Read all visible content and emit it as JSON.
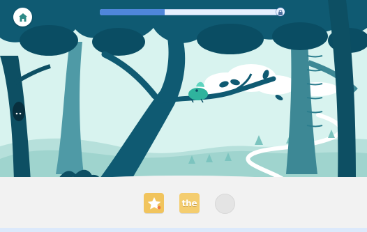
{
  "game": {
    "progress_fraction": 0.36
  },
  "controls": {
    "home_icon": "home-icon",
    "lock_icon": "lock-icon"
  },
  "collectibles": {
    "items": [
      {
        "icon": "star-icon",
        "state": "collected"
      },
      {
        "text": "the",
        "state": "collected"
      },
      {
        "icon": "empty-circle",
        "state": "empty"
      }
    ]
  },
  "colors": {
    "sky": "#cfeee9",
    "deep_teal": "#0f5a72",
    "mid_teal": "#2c7e8e",
    "light_teal": "#76c3bd",
    "progress_fill": "#4f86da",
    "tray": "#f2f2f2",
    "star_slot": "#f1c45d",
    "word_slot": "#f4cd6f"
  }
}
